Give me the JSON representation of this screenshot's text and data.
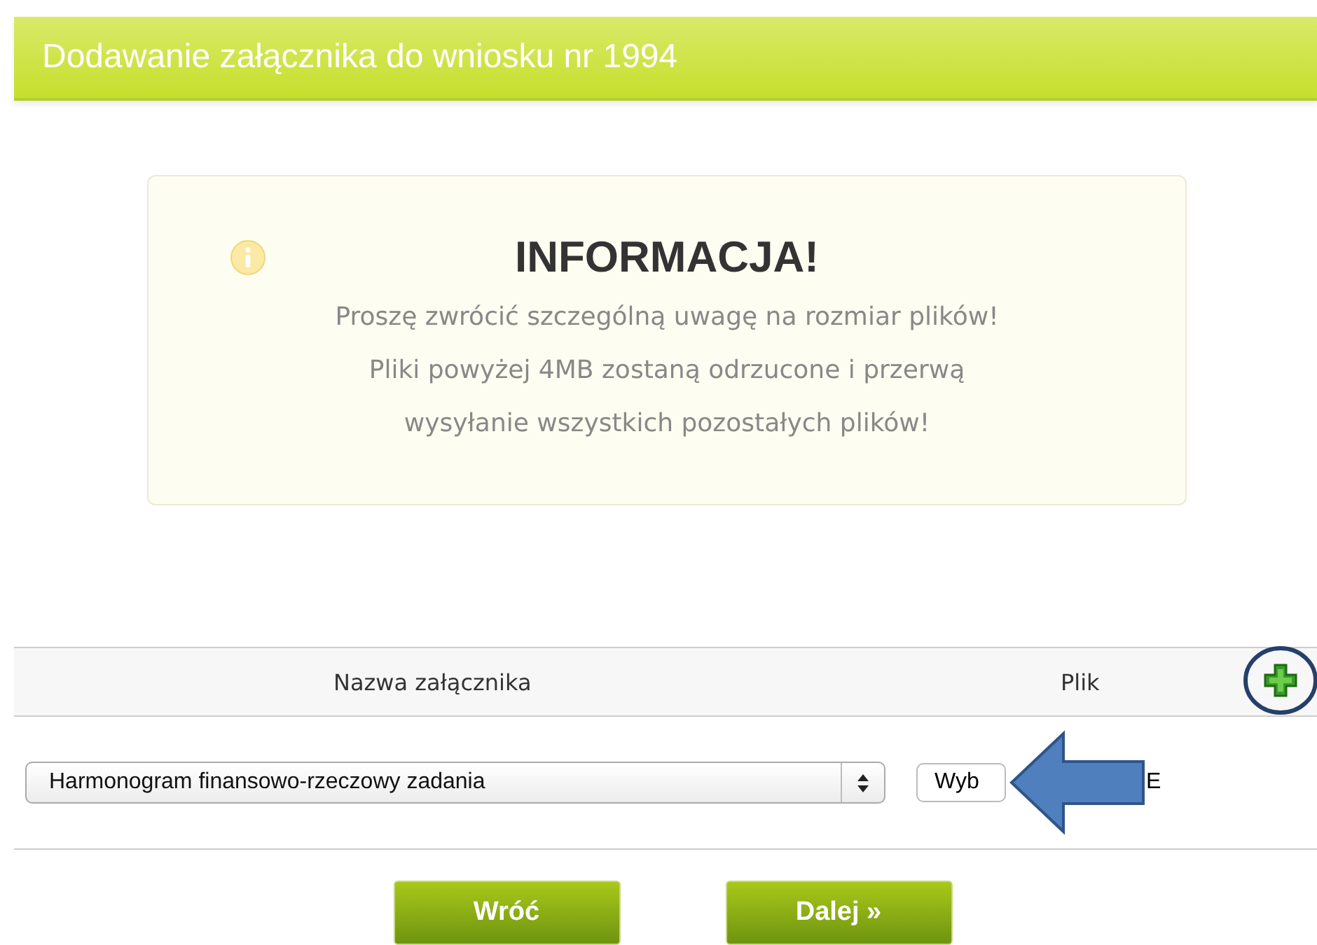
{
  "header": {
    "title": "Dodawanie załącznika do wniosku nr 1994"
  },
  "info": {
    "title": "INFORMACJA!",
    "lines": [
      "Proszę zwrócić szczególną uwagę na rozmiar plików!",
      "Pliki powyżej 4MB zostaną odrzucone i przerwą",
      "wysyłanie wszystkich pozostałych plików!"
    ]
  },
  "table": {
    "columns": [
      "Nazwa załącznika",
      "Plik"
    ],
    "rows": [
      {
        "attachment_type": "Harmonogram finansowo-rzeczowy zadania",
        "file_button": "Wyb",
        "file_status": "E"
      }
    ]
  },
  "buttons": [
    {
      "label": "Wróć"
    },
    {
      "label": "Dalej »"
    }
  ]
}
